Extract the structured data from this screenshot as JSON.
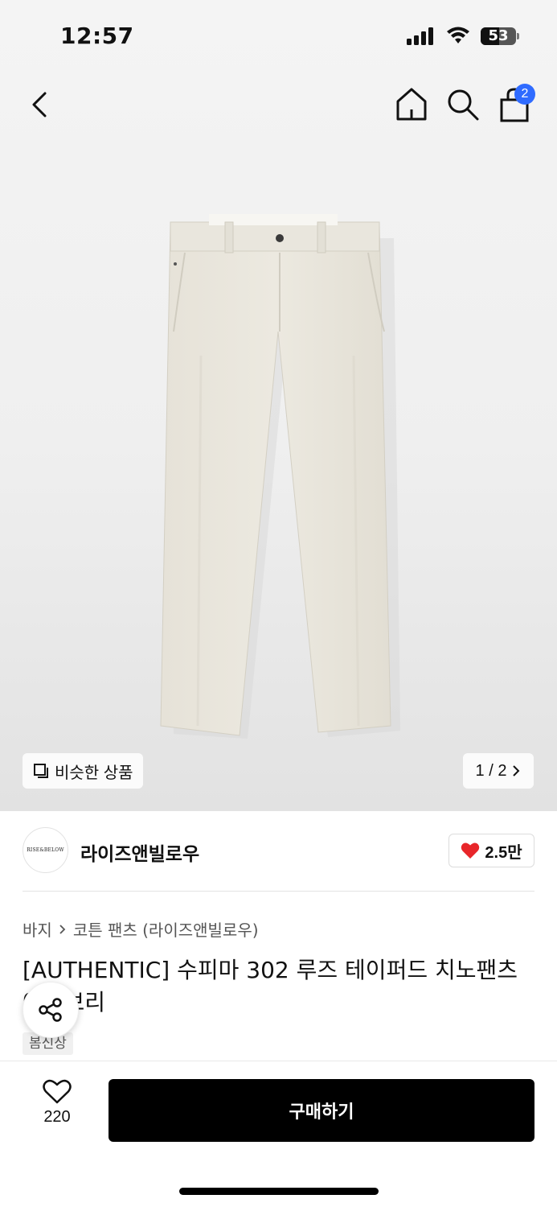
{
  "status_bar": {
    "time": "12:57",
    "battery": "53",
    "battery_level": 0.53
  },
  "header": {
    "cart_count": "2",
    "icons": [
      "back-icon",
      "home-icon",
      "search-icon",
      "shopping-bag-icon"
    ]
  },
  "image": {
    "similar_label": "비슷한 상품",
    "pager": "1 / 2"
  },
  "brand": {
    "logo_text": "RISE&BELOW",
    "name": "라이즈앤빌로우",
    "likes": "2.5만"
  },
  "breadcrumb": {
    "category": "바지",
    "subcategory": "코튼 팬츠 (라이즈앤빌로우)"
  },
  "product": {
    "title": "[AUTHENTIC] 수피마 302 루즈 테이퍼드 치노팬츠 아이보리",
    "badge": "봄신상"
  },
  "bottom_bar": {
    "wish_count": "220",
    "buy_label": "구매하기"
  },
  "colors": {
    "accent": "#2f6bff",
    "heart": "#e8262a",
    "buy_button": "#000000"
  }
}
